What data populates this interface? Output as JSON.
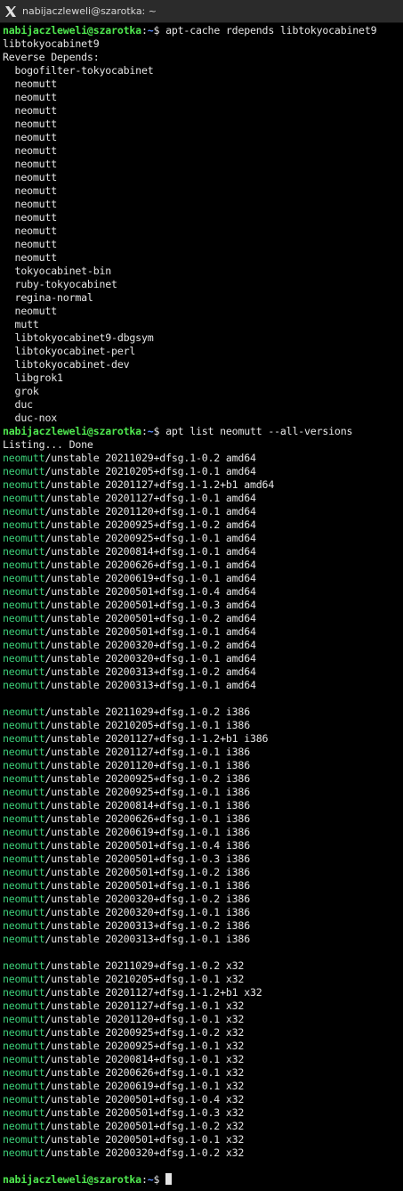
{
  "window": {
    "title": "nabijaczleweli@szarotka: ~"
  },
  "prompt": {
    "user_host": "nabijaczleweli@szarotka",
    "sep": ":",
    "path": "~",
    "symbol": "$ "
  },
  "lines": [
    {
      "t": "prompt",
      "cmd": "apt-cache rdepends libtokyocabinet9"
    },
    {
      "t": "text",
      "text": "libtokyocabinet9"
    },
    {
      "t": "text",
      "text": "Reverse Depends:"
    },
    {
      "t": "text",
      "text": "  bogofilter-tokyocabinet"
    },
    {
      "t": "text",
      "text": "  neomutt"
    },
    {
      "t": "text",
      "text": "  neomutt"
    },
    {
      "t": "text",
      "text": "  neomutt"
    },
    {
      "t": "text",
      "text": "  neomutt"
    },
    {
      "t": "text",
      "text": "  neomutt"
    },
    {
      "t": "text",
      "text": "  neomutt"
    },
    {
      "t": "text",
      "text": "  neomutt"
    },
    {
      "t": "text",
      "text": "  neomutt"
    },
    {
      "t": "text",
      "text": "  neomutt"
    },
    {
      "t": "text",
      "text": "  neomutt"
    },
    {
      "t": "text",
      "text": "  neomutt"
    },
    {
      "t": "text",
      "text": "  neomutt"
    },
    {
      "t": "text",
      "text": "  neomutt"
    },
    {
      "t": "text",
      "text": "  neomutt"
    },
    {
      "t": "text",
      "text": "  tokyocabinet-bin"
    },
    {
      "t": "text",
      "text": "  ruby-tokyocabinet"
    },
    {
      "t": "text",
      "text": "  regina-normal"
    },
    {
      "t": "text",
      "text": "  neomutt"
    },
    {
      "t": "text",
      "text": "  mutt"
    },
    {
      "t": "text",
      "text": "  libtokyocabinet9-dbgsym"
    },
    {
      "t": "text",
      "text": "  libtokyocabinet-perl"
    },
    {
      "t": "text",
      "text": "  libtokyocabinet-dev"
    },
    {
      "t": "text",
      "text": "  libgrok1"
    },
    {
      "t": "text",
      "text": "  grok"
    },
    {
      "t": "text",
      "text": "  duc"
    },
    {
      "t": "text",
      "text": "  duc-nox"
    },
    {
      "t": "prompt",
      "cmd": "apt list neomutt --all-versions"
    },
    {
      "t": "text",
      "text": "Listing... Done"
    },
    {
      "t": "pkg",
      "pkg": "neomutt",
      "rest": "/unstable 20211029+dfsg.1-0.2 amd64"
    },
    {
      "t": "pkg",
      "pkg": "neomutt",
      "rest": "/unstable 20210205+dfsg.1-0.1 amd64"
    },
    {
      "t": "pkg",
      "pkg": "neomutt",
      "rest": "/unstable 20201127+dfsg.1-1.2+b1 amd64"
    },
    {
      "t": "pkg",
      "pkg": "neomutt",
      "rest": "/unstable 20201127+dfsg.1-0.1 amd64"
    },
    {
      "t": "pkg",
      "pkg": "neomutt",
      "rest": "/unstable 20201120+dfsg.1-0.1 amd64"
    },
    {
      "t": "pkg",
      "pkg": "neomutt",
      "rest": "/unstable 20200925+dfsg.1-0.2 amd64"
    },
    {
      "t": "pkg",
      "pkg": "neomutt",
      "rest": "/unstable 20200925+dfsg.1-0.1 amd64"
    },
    {
      "t": "pkg",
      "pkg": "neomutt",
      "rest": "/unstable 20200814+dfsg.1-0.1 amd64"
    },
    {
      "t": "pkg",
      "pkg": "neomutt",
      "rest": "/unstable 20200626+dfsg.1-0.1 amd64"
    },
    {
      "t": "pkg",
      "pkg": "neomutt",
      "rest": "/unstable 20200619+dfsg.1-0.1 amd64"
    },
    {
      "t": "pkg",
      "pkg": "neomutt",
      "rest": "/unstable 20200501+dfsg.1-0.4 amd64"
    },
    {
      "t": "pkg",
      "pkg": "neomutt",
      "rest": "/unstable 20200501+dfsg.1-0.3 amd64"
    },
    {
      "t": "pkg",
      "pkg": "neomutt",
      "rest": "/unstable 20200501+dfsg.1-0.2 amd64"
    },
    {
      "t": "pkg",
      "pkg": "neomutt",
      "rest": "/unstable 20200501+dfsg.1-0.1 amd64"
    },
    {
      "t": "pkg",
      "pkg": "neomutt",
      "rest": "/unstable 20200320+dfsg.1-0.2 amd64"
    },
    {
      "t": "pkg",
      "pkg": "neomutt",
      "rest": "/unstable 20200320+dfsg.1-0.1 amd64"
    },
    {
      "t": "pkg",
      "pkg": "neomutt",
      "rest": "/unstable 20200313+dfsg.1-0.2 amd64"
    },
    {
      "t": "pkg",
      "pkg": "neomutt",
      "rest": "/unstable 20200313+dfsg.1-0.1 amd64"
    },
    {
      "t": "blank"
    },
    {
      "t": "pkg",
      "pkg": "neomutt",
      "rest": "/unstable 20211029+dfsg.1-0.2 i386"
    },
    {
      "t": "pkg",
      "pkg": "neomutt",
      "rest": "/unstable 20210205+dfsg.1-0.1 i386"
    },
    {
      "t": "pkg",
      "pkg": "neomutt",
      "rest": "/unstable 20201127+dfsg.1-1.2+b1 i386"
    },
    {
      "t": "pkg",
      "pkg": "neomutt",
      "rest": "/unstable 20201127+dfsg.1-0.1 i386"
    },
    {
      "t": "pkg",
      "pkg": "neomutt",
      "rest": "/unstable 20201120+dfsg.1-0.1 i386"
    },
    {
      "t": "pkg",
      "pkg": "neomutt",
      "rest": "/unstable 20200925+dfsg.1-0.2 i386"
    },
    {
      "t": "pkg",
      "pkg": "neomutt",
      "rest": "/unstable 20200925+dfsg.1-0.1 i386"
    },
    {
      "t": "pkg",
      "pkg": "neomutt",
      "rest": "/unstable 20200814+dfsg.1-0.1 i386"
    },
    {
      "t": "pkg",
      "pkg": "neomutt",
      "rest": "/unstable 20200626+dfsg.1-0.1 i386"
    },
    {
      "t": "pkg",
      "pkg": "neomutt",
      "rest": "/unstable 20200619+dfsg.1-0.1 i386"
    },
    {
      "t": "pkg",
      "pkg": "neomutt",
      "rest": "/unstable 20200501+dfsg.1-0.4 i386"
    },
    {
      "t": "pkg",
      "pkg": "neomutt",
      "rest": "/unstable 20200501+dfsg.1-0.3 i386"
    },
    {
      "t": "pkg",
      "pkg": "neomutt",
      "rest": "/unstable 20200501+dfsg.1-0.2 i386"
    },
    {
      "t": "pkg",
      "pkg": "neomutt",
      "rest": "/unstable 20200501+dfsg.1-0.1 i386"
    },
    {
      "t": "pkg",
      "pkg": "neomutt",
      "rest": "/unstable 20200320+dfsg.1-0.2 i386"
    },
    {
      "t": "pkg",
      "pkg": "neomutt",
      "rest": "/unstable 20200320+dfsg.1-0.1 i386"
    },
    {
      "t": "pkg",
      "pkg": "neomutt",
      "rest": "/unstable 20200313+dfsg.1-0.2 i386"
    },
    {
      "t": "pkg",
      "pkg": "neomutt",
      "rest": "/unstable 20200313+dfsg.1-0.1 i386"
    },
    {
      "t": "blank"
    },
    {
      "t": "pkg",
      "pkg": "neomutt",
      "rest": "/unstable 20211029+dfsg.1-0.2 x32"
    },
    {
      "t": "pkg",
      "pkg": "neomutt",
      "rest": "/unstable 20210205+dfsg.1-0.1 x32"
    },
    {
      "t": "pkg",
      "pkg": "neomutt",
      "rest": "/unstable 20201127+dfsg.1-1.2+b1 x32"
    },
    {
      "t": "pkg",
      "pkg": "neomutt",
      "rest": "/unstable 20201127+dfsg.1-0.1 x32"
    },
    {
      "t": "pkg",
      "pkg": "neomutt",
      "rest": "/unstable 20201120+dfsg.1-0.1 x32"
    },
    {
      "t": "pkg",
      "pkg": "neomutt",
      "rest": "/unstable 20200925+dfsg.1-0.2 x32"
    },
    {
      "t": "pkg",
      "pkg": "neomutt",
      "rest": "/unstable 20200925+dfsg.1-0.1 x32"
    },
    {
      "t": "pkg",
      "pkg": "neomutt",
      "rest": "/unstable 20200814+dfsg.1-0.1 x32"
    },
    {
      "t": "pkg",
      "pkg": "neomutt",
      "rest": "/unstable 20200626+dfsg.1-0.1 x32"
    },
    {
      "t": "pkg",
      "pkg": "neomutt",
      "rest": "/unstable 20200619+dfsg.1-0.1 x32"
    },
    {
      "t": "pkg",
      "pkg": "neomutt",
      "rest": "/unstable 20200501+dfsg.1-0.4 x32"
    },
    {
      "t": "pkg",
      "pkg": "neomutt",
      "rest": "/unstable 20200501+dfsg.1-0.3 x32"
    },
    {
      "t": "pkg",
      "pkg": "neomutt",
      "rest": "/unstable 20200501+dfsg.1-0.2 x32"
    },
    {
      "t": "pkg",
      "pkg": "neomutt",
      "rest": "/unstable 20200501+dfsg.1-0.1 x32"
    },
    {
      "t": "pkg",
      "pkg": "neomutt",
      "rest": "/unstable 20200320+dfsg.1-0.2 x32"
    },
    {
      "t": "blank"
    },
    {
      "t": "prompt",
      "cmd": "",
      "cursor": true
    }
  ]
}
